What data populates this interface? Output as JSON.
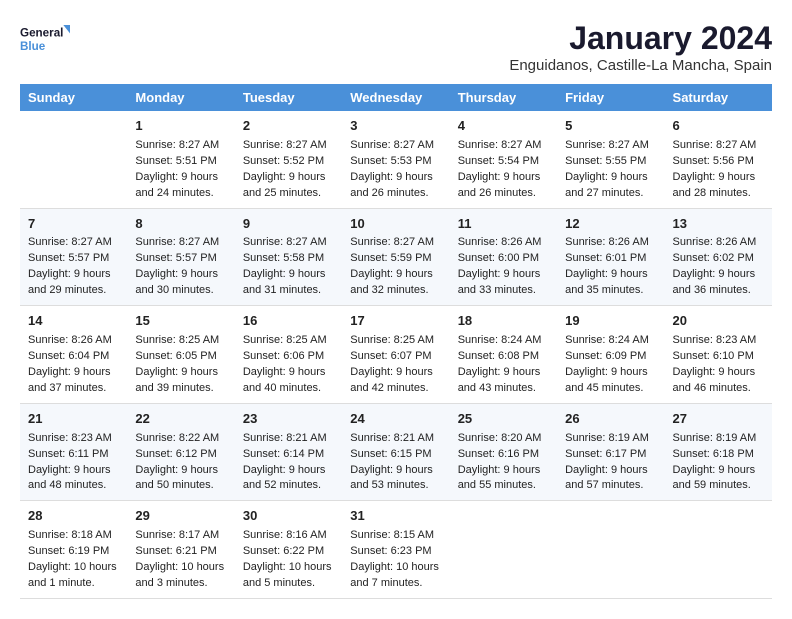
{
  "logo": {
    "line1": "General",
    "line2": "Blue"
  },
  "title": "January 2024",
  "subtitle": "Enguidanos, Castille-La Mancha, Spain",
  "weekdays": [
    "Sunday",
    "Monday",
    "Tuesday",
    "Wednesday",
    "Thursday",
    "Friday",
    "Saturday"
  ],
  "weeks": [
    [
      {
        "day": "",
        "sunrise": "",
        "sunset": "",
        "daylight": ""
      },
      {
        "day": "1",
        "sunrise": "Sunrise: 8:27 AM",
        "sunset": "Sunset: 5:51 PM",
        "daylight": "Daylight: 9 hours and 24 minutes."
      },
      {
        "day": "2",
        "sunrise": "Sunrise: 8:27 AM",
        "sunset": "Sunset: 5:52 PM",
        "daylight": "Daylight: 9 hours and 25 minutes."
      },
      {
        "day": "3",
        "sunrise": "Sunrise: 8:27 AM",
        "sunset": "Sunset: 5:53 PM",
        "daylight": "Daylight: 9 hours and 26 minutes."
      },
      {
        "day": "4",
        "sunrise": "Sunrise: 8:27 AM",
        "sunset": "Sunset: 5:54 PM",
        "daylight": "Daylight: 9 hours and 26 minutes."
      },
      {
        "day": "5",
        "sunrise": "Sunrise: 8:27 AM",
        "sunset": "Sunset: 5:55 PM",
        "daylight": "Daylight: 9 hours and 27 minutes."
      },
      {
        "day": "6",
        "sunrise": "Sunrise: 8:27 AM",
        "sunset": "Sunset: 5:56 PM",
        "daylight": "Daylight: 9 hours and 28 minutes."
      }
    ],
    [
      {
        "day": "7",
        "sunrise": "Sunrise: 8:27 AM",
        "sunset": "Sunset: 5:57 PM",
        "daylight": "Daylight: 9 hours and 29 minutes."
      },
      {
        "day": "8",
        "sunrise": "Sunrise: 8:27 AM",
        "sunset": "Sunset: 5:57 PM",
        "daylight": "Daylight: 9 hours and 30 minutes."
      },
      {
        "day": "9",
        "sunrise": "Sunrise: 8:27 AM",
        "sunset": "Sunset: 5:58 PM",
        "daylight": "Daylight: 9 hours and 31 minutes."
      },
      {
        "day": "10",
        "sunrise": "Sunrise: 8:27 AM",
        "sunset": "Sunset: 5:59 PM",
        "daylight": "Daylight: 9 hours and 32 minutes."
      },
      {
        "day": "11",
        "sunrise": "Sunrise: 8:26 AM",
        "sunset": "Sunset: 6:00 PM",
        "daylight": "Daylight: 9 hours and 33 minutes."
      },
      {
        "day": "12",
        "sunrise": "Sunrise: 8:26 AM",
        "sunset": "Sunset: 6:01 PM",
        "daylight": "Daylight: 9 hours and 35 minutes."
      },
      {
        "day": "13",
        "sunrise": "Sunrise: 8:26 AM",
        "sunset": "Sunset: 6:02 PM",
        "daylight": "Daylight: 9 hours and 36 minutes."
      }
    ],
    [
      {
        "day": "14",
        "sunrise": "Sunrise: 8:26 AM",
        "sunset": "Sunset: 6:04 PM",
        "daylight": "Daylight: 9 hours and 37 minutes."
      },
      {
        "day": "15",
        "sunrise": "Sunrise: 8:25 AM",
        "sunset": "Sunset: 6:05 PM",
        "daylight": "Daylight: 9 hours and 39 minutes."
      },
      {
        "day": "16",
        "sunrise": "Sunrise: 8:25 AM",
        "sunset": "Sunset: 6:06 PM",
        "daylight": "Daylight: 9 hours and 40 minutes."
      },
      {
        "day": "17",
        "sunrise": "Sunrise: 8:25 AM",
        "sunset": "Sunset: 6:07 PM",
        "daylight": "Daylight: 9 hours and 42 minutes."
      },
      {
        "day": "18",
        "sunrise": "Sunrise: 8:24 AM",
        "sunset": "Sunset: 6:08 PM",
        "daylight": "Daylight: 9 hours and 43 minutes."
      },
      {
        "day": "19",
        "sunrise": "Sunrise: 8:24 AM",
        "sunset": "Sunset: 6:09 PM",
        "daylight": "Daylight: 9 hours and 45 minutes."
      },
      {
        "day": "20",
        "sunrise": "Sunrise: 8:23 AM",
        "sunset": "Sunset: 6:10 PM",
        "daylight": "Daylight: 9 hours and 46 minutes."
      }
    ],
    [
      {
        "day": "21",
        "sunrise": "Sunrise: 8:23 AM",
        "sunset": "Sunset: 6:11 PM",
        "daylight": "Daylight: 9 hours and 48 minutes."
      },
      {
        "day": "22",
        "sunrise": "Sunrise: 8:22 AM",
        "sunset": "Sunset: 6:12 PM",
        "daylight": "Daylight: 9 hours and 50 minutes."
      },
      {
        "day": "23",
        "sunrise": "Sunrise: 8:21 AM",
        "sunset": "Sunset: 6:14 PM",
        "daylight": "Daylight: 9 hours and 52 minutes."
      },
      {
        "day": "24",
        "sunrise": "Sunrise: 8:21 AM",
        "sunset": "Sunset: 6:15 PM",
        "daylight": "Daylight: 9 hours and 53 minutes."
      },
      {
        "day": "25",
        "sunrise": "Sunrise: 8:20 AM",
        "sunset": "Sunset: 6:16 PM",
        "daylight": "Daylight: 9 hours and 55 minutes."
      },
      {
        "day": "26",
        "sunrise": "Sunrise: 8:19 AM",
        "sunset": "Sunset: 6:17 PM",
        "daylight": "Daylight: 9 hours and 57 minutes."
      },
      {
        "day": "27",
        "sunrise": "Sunrise: 8:19 AM",
        "sunset": "Sunset: 6:18 PM",
        "daylight": "Daylight: 9 hours and 59 minutes."
      }
    ],
    [
      {
        "day": "28",
        "sunrise": "Sunrise: 8:18 AM",
        "sunset": "Sunset: 6:19 PM",
        "daylight": "Daylight: 10 hours and 1 minute."
      },
      {
        "day": "29",
        "sunrise": "Sunrise: 8:17 AM",
        "sunset": "Sunset: 6:21 PM",
        "daylight": "Daylight: 10 hours and 3 minutes."
      },
      {
        "day": "30",
        "sunrise": "Sunrise: 8:16 AM",
        "sunset": "Sunset: 6:22 PM",
        "daylight": "Daylight: 10 hours and 5 minutes."
      },
      {
        "day": "31",
        "sunrise": "Sunrise: 8:15 AM",
        "sunset": "Sunset: 6:23 PM",
        "daylight": "Daylight: 10 hours and 7 minutes."
      },
      {
        "day": "",
        "sunrise": "",
        "sunset": "",
        "daylight": ""
      },
      {
        "day": "",
        "sunrise": "",
        "sunset": "",
        "daylight": ""
      },
      {
        "day": "",
        "sunrise": "",
        "sunset": "",
        "daylight": ""
      }
    ]
  ]
}
